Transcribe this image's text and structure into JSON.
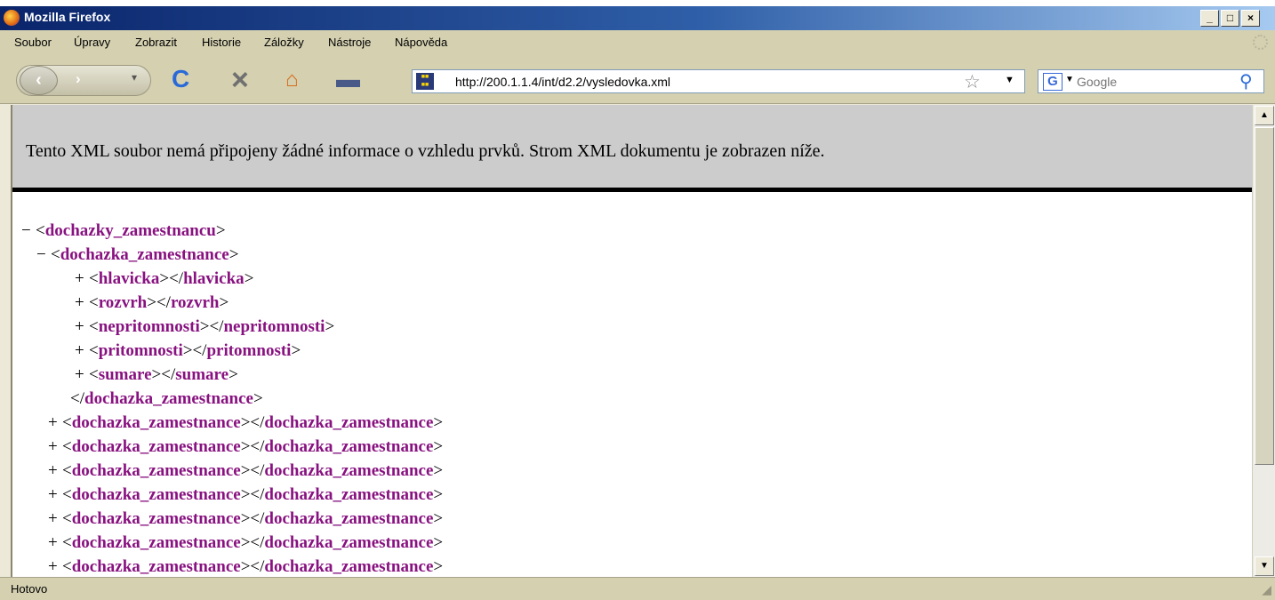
{
  "window": {
    "title": "Mozilla Firefox"
  },
  "menu": [
    "Soubor",
    "Úpravy",
    "Zobrazit",
    "Historie",
    "Záložky",
    "Nástroje",
    "Nápověda"
  ],
  "address": {
    "url": "http://200.1.1.4/int/d2.2/vysledovka.xml"
  },
  "search": {
    "placeholder": "Google"
  },
  "info_message": "Tento XML soubor nemá připojeny žádné informace o vzhledu prvků. Strom XML dokumentu je zobrazen níže.",
  "xml_tree": [
    {
      "sym": "−",
      "open": "dochazky_zamestnancu",
      "close": ""
    },
    {
      "sym": "−",
      "open": "dochazka_zamestnance",
      "close": ""
    },
    {
      "sym": "+",
      "open": "hlavicka",
      "close": "hlavicka"
    },
    {
      "sym": "+",
      "open": "rozvrh",
      "close": "rozvrh"
    },
    {
      "sym": "+",
      "open": "nepritomnosti",
      "close": "nepritomnosti"
    },
    {
      "sym": "+",
      "open": "pritomnosti",
      "close": "pritomnosti"
    },
    {
      "sym": "+",
      "open": "sumare",
      "close": "sumare"
    },
    {
      "sym": "",
      "open": "",
      "close": "dochazka_zamestnance"
    },
    {
      "sym": "+",
      "open": "dochazka_zamestnance",
      "close": "dochazka_zamestnance"
    },
    {
      "sym": "+",
      "open": "dochazka_zamestnance",
      "close": "dochazka_zamestnance"
    },
    {
      "sym": "+",
      "open": "dochazka_zamestnance",
      "close": "dochazka_zamestnance"
    },
    {
      "sym": "+",
      "open": "dochazka_zamestnance",
      "close": "dochazka_zamestnance"
    },
    {
      "sym": "+",
      "open": "dochazka_zamestnance",
      "close": "dochazka_zamestnance"
    },
    {
      "sym": "+",
      "open": "dochazka_zamestnance",
      "close": "dochazka_zamestnance"
    },
    {
      "sym": "+",
      "open": "dochazka_zamestnance",
      "close": "dochazka_zamestnance"
    }
  ],
  "status": "Hotovo"
}
